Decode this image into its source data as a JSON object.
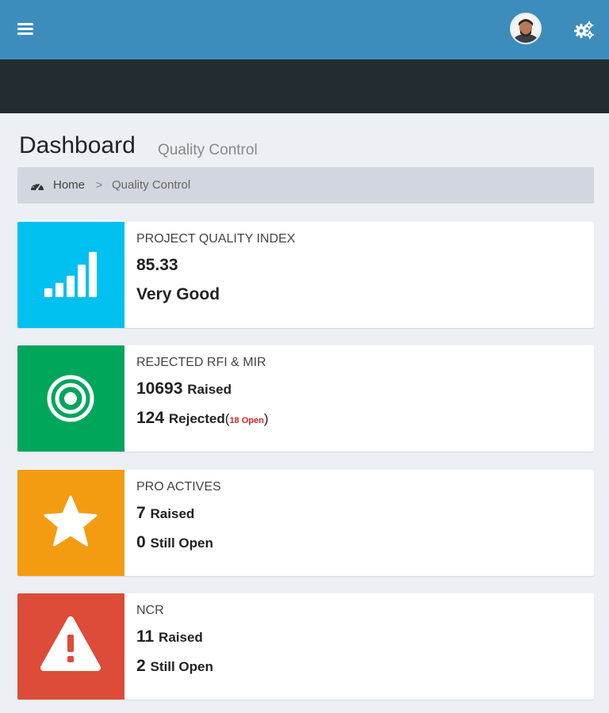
{
  "page": {
    "title": "Dashboard",
    "subtitle": "Quality Control"
  },
  "breadcrumb": {
    "home": "Home",
    "separator": ">",
    "current": "Quality Control"
  },
  "boxes": [
    {
      "label": "PROJECT QUALITY INDEX",
      "value": "85.33",
      "rating": "Very Good",
      "icon": "signal-bars-icon",
      "color": "#00c0ef"
    },
    {
      "label": "REJECTED RFI & MIR",
      "raised_count": "10693",
      "raised_label": "Raised",
      "rejected_count": "124",
      "rejected_label": "Rejected",
      "open_note": "18 Open",
      "paren_open": "(",
      "paren_close": ")",
      "icon": "target-icon",
      "color": "#00a65a"
    },
    {
      "label": "PRO ACTIVES",
      "raised_count": "7",
      "raised_label": "Raised",
      "open_count": "0",
      "open_label": "Still Open",
      "icon": "star-icon",
      "color": "#f39c12"
    },
    {
      "label": "NCR",
      "raised_count": "11",
      "raised_label": "Raised",
      "open_count": "2",
      "open_label": "Still Open",
      "icon": "warning-icon",
      "color": "#dd4b39"
    }
  ],
  "colors": {
    "header": "#3c8dbc",
    "dark_band": "#222d32",
    "background": "#ecf0f5"
  }
}
